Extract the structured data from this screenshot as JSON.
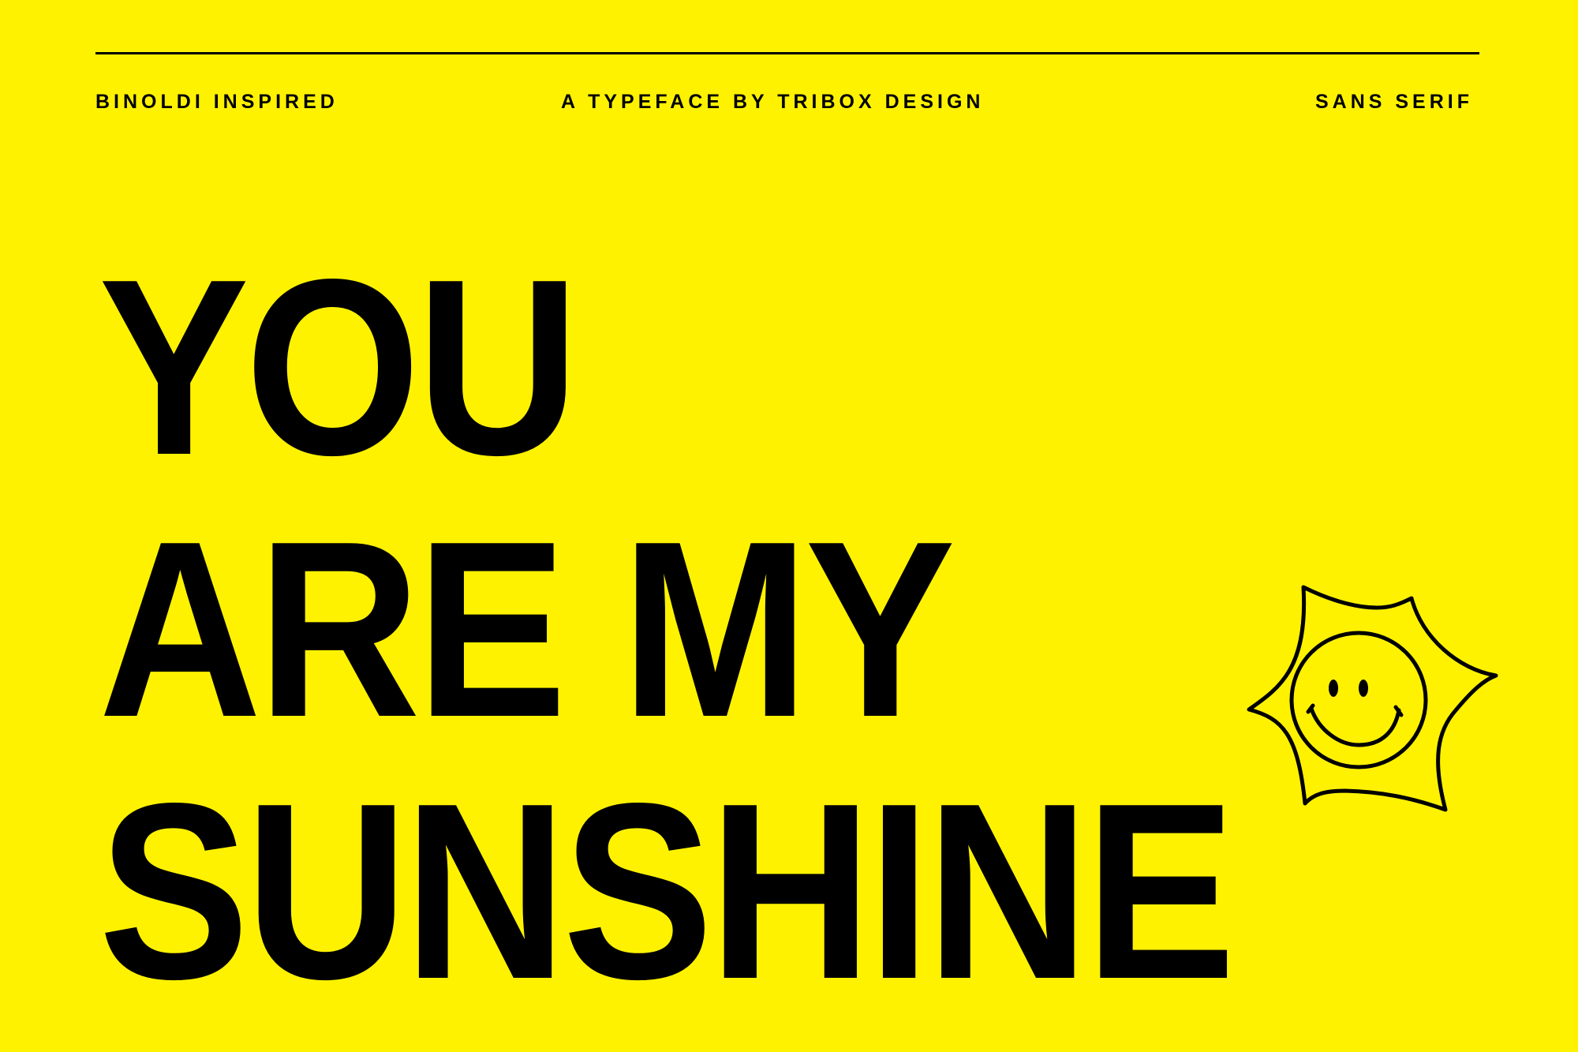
{
  "header": {
    "left_label": "BINOLDI INSPIRED",
    "center_label": "A TYPEFACE BY TRIBOX DESIGN",
    "right_label": "SANS SERIF"
  },
  "headline": {
    "lines": [
      "YOU",
      "ARE MY",
      "SUNSHINE"
    ]
  },
  "illustration": {
    "icon": "smiling-sun-icon"
  },
  "colors": {
    "background": "#FFF200",
    "ink": "#000000"
  }
}
